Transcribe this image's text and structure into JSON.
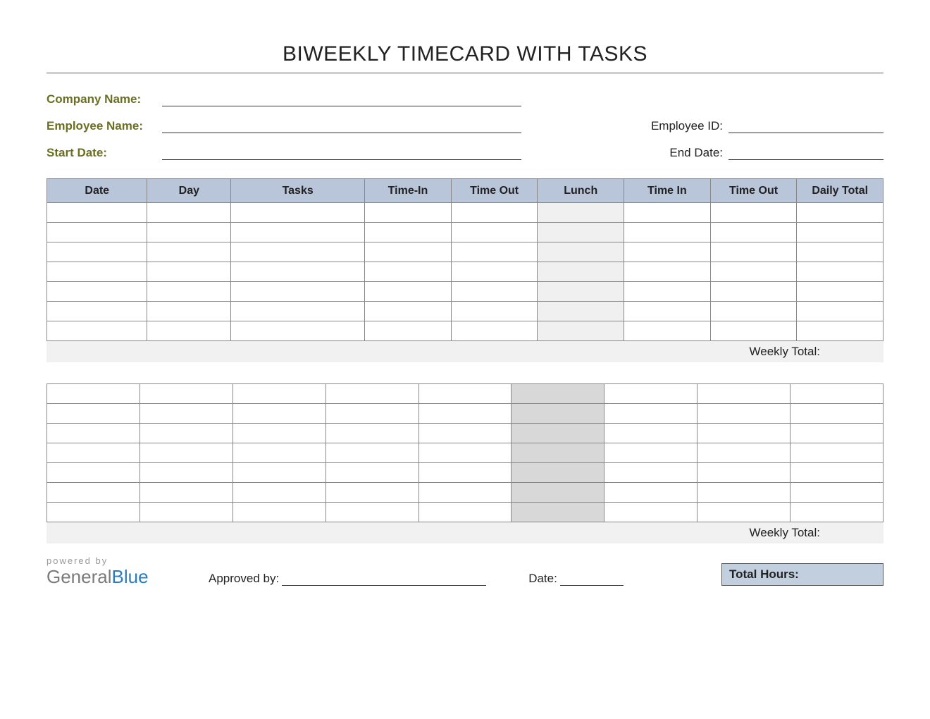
{
  "title": "BIWEEKLY TIMECARD WITH TASKS",
  "header": {
    "company_label": "Company Name:",
    "employee_label": "Employee Name:",
    "start_label": "Start Date:",
    "empid_label": "Employee ID:",
    "end_label": "End Date:",
    "company_value": "",
    "employee_value": "",
    "start_value": "",
    "empid_value": "",
    "end_value": ""
  },
  "columns": {
    "date": "Date",
    "day": "Day",
    "tasks": "Tasks",
    "timein1": "Time-In",
    "timeout1": "Time Out",
    "lunch": "Lunch",
    "timein2": "Time In",
    "timeout2": "Time Out",
    "daily": "Daily Total"
  },
  "week1_rows": 7,
  "week2_rows": 7,
  "weekly_total_label": "Weekly Total:",
  "footer": {
    "powered_by": "powered by",
    "brand_a": "General",
    "brand_b": "Blue",
    "approved_label": "Approved by:",
    "approved_value": "",
    "date_label": "Date:",
    "date_value": "",
    "total_hours_label": "Total Hours:"
  }
}
